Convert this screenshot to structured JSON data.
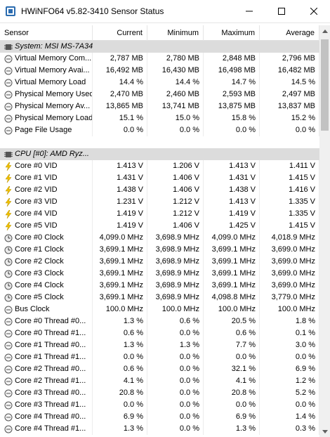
{
  "window": {
    "title": "HWiNFO64 v5.82-3410 Sensor Status"
  },
  "columns": [
    "Sensor",
    "Current",
    "Minimum",
    "Maximum",
    "Average"
  ],
  "rows": [
    {
      "type": "section",
      "icon": "chip-icon",
      "name": "System: MSI MS-7A34"
    },
    {
      "type": "data",
      "icon": "gauge-icon",
      "name": "Virtual Memory Com...",
      "cur": "2,787 MB",
      "min": "2,780 MB",
      "max": "2,848 MB",
      "avg": "2,796 MB"
    },
    {
      "type": "data",
      "icon": "gauge-icon",
      "name": "Virtual Memory Avai...",
      "cur": "16,492 MB",
      "min": "16,430 MB",
      "max": "16,498 MB",
      "avg": "16,482 MB"
    },
    {
      "type": "data",
      "icon": "gauge-icon",
      "name": "Virtual Memory Load",
      "cur": "14.4 %",
      "min": "14.4 %",
      "max": "14.7 %",
      "avg": "14.5 %"
    },
    {
      "type": "data",
      "icon": "gauge-icon",
      "name": "Physical Memory Used",
      "cur": "2,470 MB",
      "min": "2,460 MB",
      "max": "2,593 MB",
      "avg": "2,497 MB"
    },
    {
      "type": "data",
      "icon": "gauge-icon",
      "name": "Physical Memory Av...",
      "cur": "13,865 MB",
      "min": "13,741 MB",
      "max": "13,875 MB",
      "avg": "13,837 MB"
    },
    {
      "type": "data",
      "icon": "gauge-icon",
      "name": "Physical Memory Load",
      "cur": "15.1 %",
      "min": "15.0 %",
      "max": "15.8 %",
      "avg": "15.2 %"
    },
    {
      "type": "data",
      "icon": "gauge-icon",
      "name": "Page File Usage",
      "cur": "0.0 %",
      "min": "0.0 %",
      "max": "0.0 %",
      "avg": "0.0 %"
    },
    {
      "type": "blank"
    },
    {
      "type": "section",
      "icon": "chip-icon",
      "name": "CPU [#0]: AMD Ryz..."
    },
    {
      "type": "data",
      "icon": "voltage-icon",
      "name": "Core #0 VID",
      "cur": "1.413 V",
      "min": "1.206 V",
      "max": "1.413 V",
      "avg": "1.411 V"
    },
    {
      "type": "data",
      "icon": "voltage-icon",
      "name": "Core #1 VID",
      "cur": "1.431 V",
      "min": "1.406 V",
      "max": "1.431 V",
      "avg": "1.415 V"
    },
    {
      "type": "data",
      "icon": "voltage-icon",
      "name": "Core #2 VID",
      "cur": "1.438 V",
      "min": "1.406 V",
      "max": "1.438 V",
      "avg": "1.416 V"
    },
    {
      "type": "data",
      "icon": "voltage-icon",
      "name": "Core #3 VID",
      "cur": "1.231 V",
      "min": "1.212 V",
      "max": "1.413 V",
      "avg": "1.335 V"
    },
    {
      "type": "data",
      "icon": "voltage-icon",
      "name": "Core #4 VID",
      "cur": "1.419 V",
      "min": "1.212 V",
      "max": "1.419 V",
      "avg": "1.335 V"
    },
    {
      "type": "data",
      "icon": "voltage-icon",
      "name": "Core #5 VID",
      "cur": "1.419 V",
      "min": "1.406 V",
      "max": "1.425 V",
      "avg": "1.415 V"
    },
    {
      "type": "data",
      "icon": "clock-icon",
      "name": "Core #0 Clock",
      "cur": "4,099.0 MHz",
      "min": "3,698.9 MHz",
      "max": "4,099.0 MHz",
      "avg": "4,018.9 MHz"
    },
    {
      "type": "data",
      "icon": "clock-icon",
      "name": "Core #1 Clock",
      "cur": "3,699.1 MHz",
      "min": "3,698.9 MHz",
      "max": "3,699.1 MHz",
      "avg": "3,699.0 MHz"
    },
    {
      "type": "data",
      "icon": "clock-icon",
      "name": "Core #2 Clock",
      "cur": "3,699.1 MHz",
      "min": "3,698.9 MHz",
      "max": "3,699.1 MHz",
      "avg": "3,699.0 MHz"
    },
    {
      "type": "data",
      "icon": "clock-icon",
      "name": "Core #3 Clock",
      "cur": "3,699.1 MHz",
      "min": "3,698.9 MHz",
      "max": "3,699.1 MHz",
      "avg": "3,699.0 MHz"
    },
    {
      "type": "data",
      "icon": "clock-icon",
      "name": "Core #4 Clock",
      "cur": "3,699.1 MHz",
      "min": "3,698.9 MHz",
      "max": "3,699.1 MHz",
      "avg": "3,699.0 MHz"
    },
    {
      "type": "data",
      "icon": "clock-icon",
      "name": "Core #5 Clock",
      "cur": "3,699.1 MHz",
      "min": "3,698.9 MHz",
      "max": "4,098.8 MHz",
      "avg": "3,779.0 MHz"
    },
    {
      "type": "data",
      "icon": "gauge-icon",
      "name": "Bus Clock",
      "cur": "100.0 MHz",
      "min": "100.0 MHz",
      "max": "100.0 MHz",
      "avg": "100.0 MHz"
    },
    {
      "type": "data",
      "icon": "gauge-icon",
      "name": "Core #0 Thread #0...",
      "cur": "1.3 %",
      "min": "0.6 %",
      "max": "20.5 %",
      "avg": "1.8 %"
    },
    {
      "type": "data",
      "icon": "gauge-icon",
      "name": "Core #0 Thread #1...",
      "cur": "0.6 %",
      "min": "0.0 %",
      "max": "0.6 %",
      "avg": "0.1 %"
    },
    {
      "type": "data",
      "icon": "gauge-icon",
      "name": "Core #1 Thread #0...",
      "cur": "1.3 %",
      "min": "1.3 %",
      "max": "7.7 %",
      "avg": "3.0 %"
    },
    {
      "type": "data",
      "icon": "gauge-icon",
      "name": "Core #1 Thread #1...",
      "cur": "0.0 %",
      "min": "0.0 %",
      "max": "0.0 %",
      "avg": "0.0 %"
    },
    {
      "type": "data",
      "icon": "gauge-icon",
      "name": "Core #2 Thread #0...",
      "cur": "0.6 %",
      "min": "0.0 %",
      "max": "32.1 %",
      "avg": "6.9 %"
    },
    {
      "type": "data",
      "icon": "gauge-icon",
      "name": "Core #2 Thread #1...",
      "cur": "4.1 %",
      "min": "0.0 %",
      "max": "4.1 %",
      "avg": "1.2 %"
    },
    {
      "type": "data",
      "icon": "gauge-icon",
      "name": "Core #3 Thread #0...",
      "cur": "20.8 %",
      "min": "0.0 %",
      "max": "20.8 %",
      "avg": "5.2 %"
    },
    {
      "type": "data",
      "icon": "gauge-icon",
      "name": "Core #3 Thread #1...",
      "cur": "0.0 %",
      "min": "0.0 %",
      "max": "0.0 %",
      "avg": "0.0 %"
    },
    {
      "type": "data",
      "icon": "gauge-icon",
      "name": "Core #4 Thread #0...",
      "cur": "6.9 %",
      "min": "0.0 %",
      "max": "6.9 %",
      "avg": "1.4 %"
    },
    {
      "type": "data",
      "icon": "gauge-icon",
      "name": "Core #4 Thread #1...",
      "cur": "1.3 %",
      "min": "0.0 %",
      "max": "1.3 %",
      "avg": "0.3 %"
    }
  ]
}
